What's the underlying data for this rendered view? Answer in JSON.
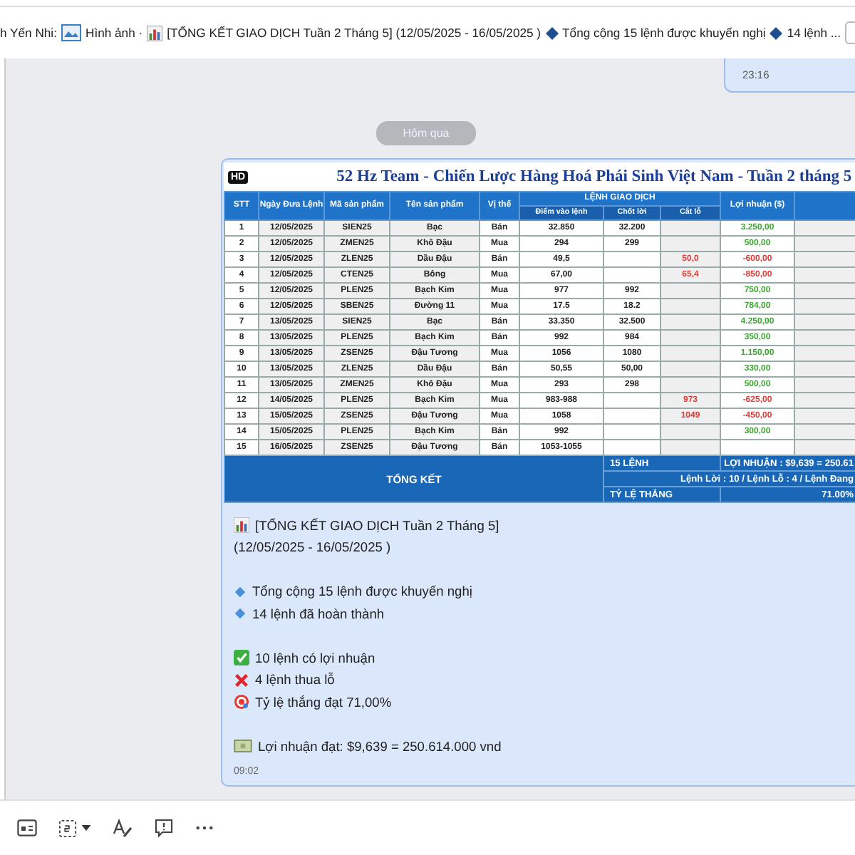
{
  "preview_bar": {
    "sender": "h Yến Nhi:",
    "segments": [
      "Hình ảnh ·",
      "[TỔNG KẾT GIAO DỊCH Tuần 2 Tháng 5]  (12/05/2025 - 16/05/2025 )",
      "Tổng cộng 15 lệnh được khuyến nghị",
      "14 lệnh ..."
    ]
  },
  "sent_message": {
    "time": "23:16"
  },
  "date_divider": "Hôm qua",
  "message": {
    "image": {
      "badge": "HD",
      "title": "52 Hz Team - Chiến Lược Hàng Hoá Phái Sinh Việt Nam - Tuần 2 tháng 5",
      "headers": {
        "stt": "STT",
        "date": "Ngày Đưa Lệnh",
        "code": "Mã sản phẩm",
        "name": "Tên sản phẩm",
        "side": "Vị thế",
        "group": "LỆNH GIAO DỊCH",
        "entry": "Điểm vào lệnh",
        "take_profit": "Chốt lời",
        "stop_loss": "Cắt lỗ",
        "profit": "Lợi nhuận ($)"
      },
      "rows": [
        {
          "stt": "1",
          "date": "12/05/2025",
          "code": "SIEN25",
          "name": "Bạc",
          "side": "Bán",
          "entry": "32.850",
          "take_profit": "32.200",
          "profit": "3.250,00",
          "loss": false
        },
        {
          "stt": "2",
          "date": "12/05/2025",
          "code": "ZMEN25",
          "name": "Khô Đậu",
          "side": "Mua",
          "entry": "294",
          "take_profit": "299",
          "profit": "500,00",
          "loss": false
        },
        {
          "stt": "3",
          "date": "12/05/2025",
          "code": "ZLEN25",
          "name": "Dầu Đậu",
          "side": "Bán",
          "entry": "49,5",
          "stop_loss": "50,0",
          "profit": "-600,00",
          "loss": true
        },
        {
          "stt": "4",
          "date": "12/05/2025",
          "code": "CTEN25",
          "name": "Bông",
          "side": "Mua",
          "entry": "67,00",
          "stop_loss": "65,4",
          "profit": "-850,00",
          "loss": true
        },
        {
          "stt": "5",
          "date": "12/05/2025",
          "code": "PLEN25",
          "name": "Bạch Kim",
          "side": "Mua",
          "entry": "977",
          "take_profit": "992",
          "profit": "750,00",
          "loss": false
        },
        {
          "stt": "6",
          "date": "12/05/2025",
          "code": "SBEN25",
          "name": "Đường 11",
          "side": "Mua",
          "entry": "17.5",
          "take_profit": "18.2",
          "profit": "784,00",
          "loss": false
        },
        {
          "stt": "7",
          "date": "13/05/2025",
          "code": "SIEN25",
          "name": "Bạc",
          "side": "Bán",
          "entry": "33.350",
          "take_profit": "32.500",
          "profit": "4.250,00",
          "loss": false
        },
        {
          "stt": "8",
          "date": "13/05/2025",
          "code": "PLEN25",
          "name": "Bạch Kim",
          "side": "Bán",
          "entry": "992",
          "take_profit": "984",
          "profit": "350,00",
          "loss": false
        },
        {
          "stt": "9",
          "date": "13/05/2025",
          "code": "ZSEN25",
          "name": "Đậu Tương",
          "side": "Mua",
          "entry": "1056",
          "take_profit": "1080",
          "profit": "1.150,00",
          "loss": false
        },
        {
          "stt": "10",
          "date": "13/05/2025",
          "code": "ZLEN25",
          "name": "Dầu Đậu",
          "side": "Bán",
          "entry": "50,55",
          "take_profit": "50,00",
          "profit": "330,00",
          "loss": false
        },
        {
          "stt": "11",
          "date": "13/05/2025",
          "code": "ZMEN25",
          "name": "Khô Đậu",
          "side": "Mua",
          "entry": "293",
          "take_profit": "298",
          "profit": "500,00",
          "loss": false
        },
        {
          "stt": "12",
          "date": "14/05/2025",
          "code": "PLEN25",
          "name": "Bạch Kim",
          "side": "Mua",
          "entry": "983-988",
          "stop_loss": "973",
          "profit": "-625,00",
          "loss": true
        },
        {
          "stt": "13",
          "date": "15/05/2025",
          "code": "ZSEN25",
          "name": "Đậu Tương",
          "side": "Mua",
          "entry": "1058",
          "stop_loss": "1049",
          "profit": "-450,00",
          "loss": true
        },
        {
          "stt": "14",
          "date": "15/05/2025",
          "code": "PLEN25",
          "name": "Bạch Kim",
          "side": "Bán",
          "entry": "992",
          "profit": "300,00",
          "loss": false
        },
        {
          "stt": "15",
          "date": "16/05/2025",
          "code": "ZSEN25",
          "name": "Đậu Tương",
          "side": "Bán",
          "entry": "1053-1055"
        }
      ],
      "summary": {
        "label": "TỔNG KẾT",
        "count": "15 LỆNH",
        "profit": "LỢI NHUẬN : $9,639 = 250.61",
        "breakdown": "Lệnh Lời : 10 / Lệnh Lỗ : 4 / Lệnh Đang",
        "win_rate_label": "TỶ LỆ THẮNG",
        "win_rate": "71.00%"
      }
    },
    "title_lines": [
      "[TỔNG KẾT GIAO DỊCH Tuần 2 Tháng 5]",
      "(12/05/2025 - 16/05/2025 )"
    ],
    "bullets": [
      "Tổng cộng 15 lệnh được khuyến nghị",
      "14 lệnh đã hoàn thành"
    ],
    "results": [
      "10 lệnh có lợi nhuận",
      "4 lệnh thua lỗ",
      "Tỷ lệ thắng đạt 71,00%"
    ],
    "profit_line": "Lợi nhuận đạt: $9,639 = 250.614.000 vnd",
    "time": "09:02"
  }
}
